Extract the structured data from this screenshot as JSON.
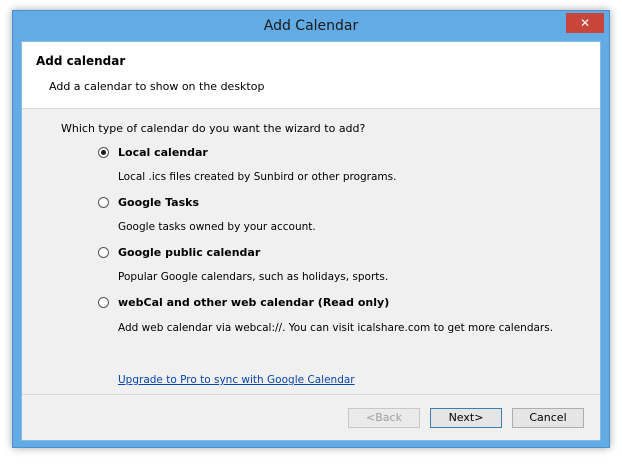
{
  "window": {
    "title": "Add Calendar",
    "close_glyph": "✕"
  },
  "header": {
    "title": "Add calendar",
    "subtitle": "Add a calendar to show on the desktop"
  },
  "question": "Which type of calendar do you want the wizard to add?",
  "options": [
    {
      "label": "Local calendar",
      "description": "Local .ics files created by Sunbird or other programs.",
      "checked": true
    },
    {
      "label": "Google Tasks",
      "description": "Google tasks owned by your account.",
      "checked": false
    },
    {
      "label": "Google public calendar",
      "description": "Popular Google calendars, such as holidays, sports.",
      "checked": false
    },
    {
      "label": "webCal and other web calendar (Read only)",
      "description": "Add web calendar via webcal://. You can visit icalshare.com to get more calendars.",
      "checked": false
    }
  ],
  "upgrade_link": "Upgrade to Pro to sync with Google Calendar",
  "buttons": {
    "back": "<Back",
    "next": "Next>",
    "cancel": "Cancel"
  }
}
